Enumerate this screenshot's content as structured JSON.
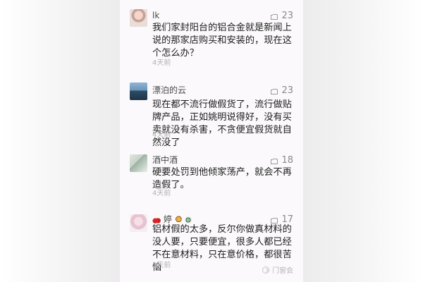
{
  "comments": [
    {
      "author": "lk",
      "likes": "23",
      "text": "我们家封阳台的铝合金就是新闻上说的那家店购买和安装的，现在这个怎么办？",
      "time": "4天前"
    },
    {
      "author": "漂泊的云",
      "likes": "23",
      "text": "现在都不流行做假货了，流行做贴牌产品，正如姚明说得好，没有买卖就没有杀害，不贪便宜假货就自然没了",
      "time": "4天前"
    },
    {
      "author": "酒中酒",
      "likes": "18",
      "text": "硬要处罚到他倾家荡产，就会不再造假了。",
      "time": "4天前"
    },
    {
      "author": "婷",
      "likes": "17",
      "text": "铝材假的太多，反尔你做真材料的没人要，只要便宜，很多人都已经不在意材料，只在意价格，都很苦恼",
      "time": "3天前"
    }
  ],
  "watermark": {
    "text": "门窗会"
  }
}
